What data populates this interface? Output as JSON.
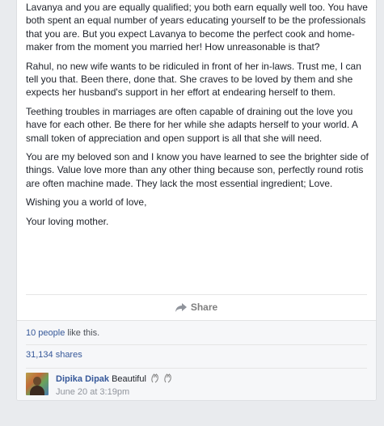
{
  "post": {
    "paragraphs": [
      "Lavanya and you are equally qualified; you both earn equally well too. You have both spent an equal number of years educating yourself to be the professionals that you are. But you expect Lavanya to become the perfect cook and home-maker from the moment you married her! How unreasonable is that?",
      "Rahul, no new wife wants to be ridiculed in front of her in-laws. Trust me, I can tell you that. Been there, done that. She craves to be loved by them and she expects her husband's support in her effort at endearing herself to them.",
      "Teething troubles in marriages are often capable of draining out the love you have for each other. Be there for her while she adapts herself to your world. A small token of appreciation and open support is all that she will need.",
      "You are my beloved son and I know you have learned to see the brighter side of things. Value love more than any other thing because son, perfectly round rotis are often machine made. They lack the most essential ingredient; Love.",
      "Wishing you a world of love,",
      "Your loving mother."
    ]
  },
  "actions": {
    "share_label": "Share",
    "share_icon": "share-arrow-icon"
  },
  "footer": {
    "likes_link": "10 people",
    "likes_suffix": " like this.",
    "shares_text": "31,134 shares"
  },
  "comment": {
    "author": "Dipika Dipak",
    "text": "Beautiful",
    "emoji_icons": [
      "clapping-hands-icon",
      "clapping-hands-icon"
    ],
    "timestamp": "June 20 at 3:19pm"
  },
  "colors": {
    "link": "#365899",
    "text": "#1d2129",
    "muted": "#90949c",
    "background": "#e9ebee"
  }
}
